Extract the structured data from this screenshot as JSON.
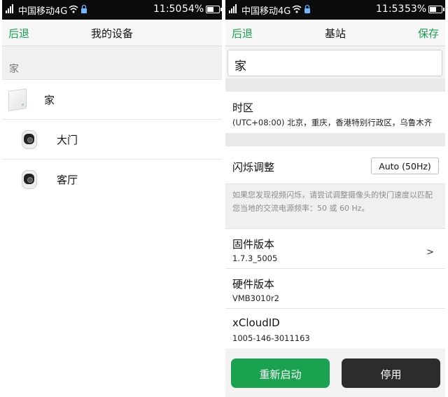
{
  "left": {
    "status": {
      "carrier": "中国移动4G",
      "time": "11:50",
      "battery": "54%"
    },
    "nav": {
      "back": "后退",
      "title": "我的设备"
    },
    "section_header": "家",
    "devices": [
      {
        "label": "家",
        "icon": "base-station-icon"
      },
      {
        "label": "大门",
        "icon": "camera-icon"
      },
      {
        "label": "客厅",
        "icon": "camera-icon"
      }
    ]
  },
  "right": {
    "status": {
      "carrier": "中国移动4G",
      "time": "11:53",
      "battery": "53%"
    },
    "nav": {
      "back": "后退",
      "title": "基站",
      "save": "保存"
    },
    "name_value": "家",
    "timezone": {
      "label": "时区",
      "value": "(UTC+08:00) 北京，重庆，香港特别行政区，乌鲁木齐"
    },
    "flicker": {
      "label": "闪烁调整",
      "value": "Auto (50Hz)"
    },
    "flicker_hint": "如果您发现视频闪烁，请尝试调整摄像头的快门速度以匹配您当地的交流电源频率：50 或 60 Hz。",
    "firmware": {
      "label": "固件版本",
      "value": "1.7.3_5005",
      "chevron": ">"
    },
    "hardware": {
      "label": "硬件版本",
      "value": "VMB3010r2"
    },
    "xcloud": {
      "label": "xCloudID",
      "value": "1005-146-3011163"
    },
    "restart_button": "重新启动",
    "disable_button": "停用"
  },
  "colors": {
    "accent": "#1aa251",
    "dark_button": "#2c2c2c",
    "status_bar": "#0c0c0c"
  }
}
